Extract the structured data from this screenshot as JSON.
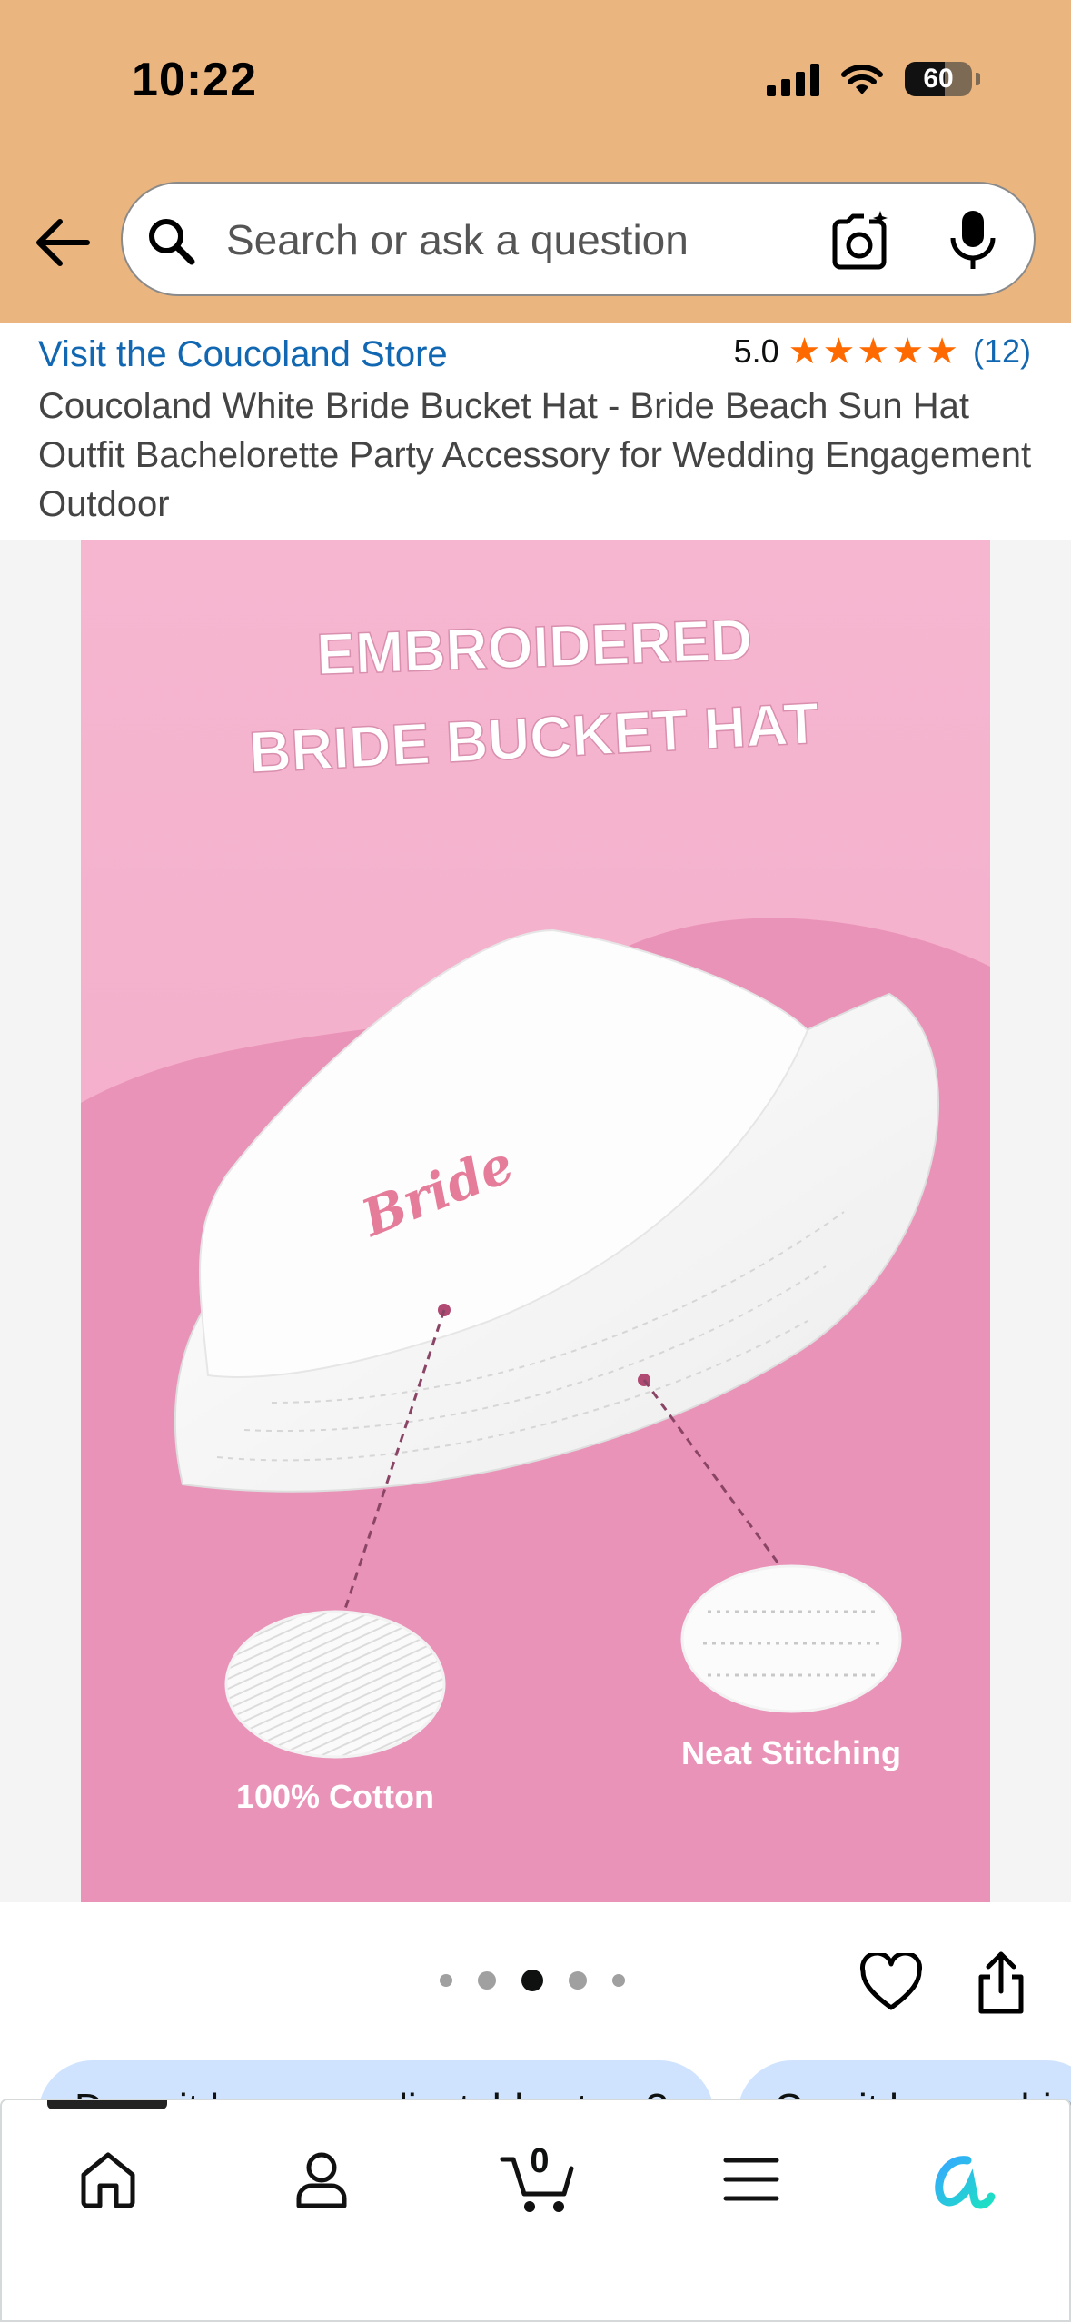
{
  "status_bar": {
    "time": "10:22",
    "battery": "60",
    "battery_level": 0.6
  },
  "search": {
    "placeholder": "Search or ask a question"
  },
  "product": {
    "store_link": "Visit the Coucoland Store",
    "rating_value": "5.0",
    "rating_stars": 5,
    "rating_count": "(12)",
    "title": "Coucoland White Bride Bucket Hat - Bride Beach Sun Hat Outfit Bachelorette Party Accessory for Wedding Engagement Outdoor"
  },
  "image": {
    "headline_line1": "EMBROIDERED",
    "headline_line2": "BRIDE BUCKET HAT",
    "embroidery": "Bride",
    "feature_left": "100% Cotton",
    "feature_right": "Neat Stitching"
  },
  "carousel": {
    "total": 5,
    "active_index": 2
  },
  "chips": [
    {
      "label": "Does it have an adjustable strap?"
    },
    {
      "label": "Can it be machine washed?"
    }
  ],
  "bottom_nav": {
    "cart_count": "0"
  },
  "colors": {
    "header_bg": "#ebb57f",
    "link": "#1167b1",
    "star": "#ff6a00",
    "image_pink": "#f3b3cd"
  }
}
